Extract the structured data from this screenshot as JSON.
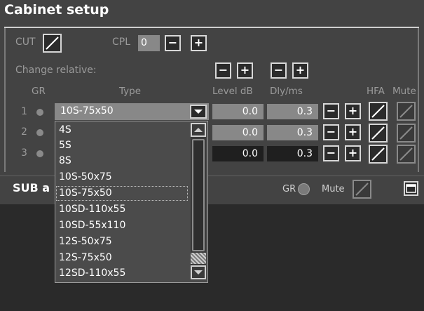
{
  "window_title": "Cabinet setup",
  "top_controls": {
    "cut_label": "CUT",
    "cpl_label": "CPL",
    "cpl_value": "0",
    "minus": "−",
    "plus": "+"
  },
  "change_relative_label": "Change relative:",
  "headers": {
    "gr": "GR",
    "type": "Type",
    "level": "Level dB",
    "dly": "Dly/ms",
    "hfa": "HFA",
    "mute": "Mute"
  },
  "rows": [
    {
      "gr": "1",
      "type": "10S-75x50",
      "level": "0.0",
      "dly": "0.3"
    },
    {
      "gr": "2",
      "level": "0.0",
      "dly": "0.3"
    },
    {
      "gr": "3",
      "level": "0.0",
      "dly": "0.3"
    }
  ],
  "dropdown_options": [
    "4S",
    "5S",
    "8S",
    "10S-50x75",
    "10S-75x50",
    "10SD-110x55",
    "10SD-55x110",
    "12S-50x75",
    "12S-75x50",
    "12SD-110x55"
  ],
  "dropdown_selected": "10S-75x50",
  "sub_section": {
    "title": "SUB a",
    "gr_label": "GR",
    "mute_label": "Mute"
  },
  "colors": {
    "panel_bg": "#434343",
    "field_gray": "#888888",
    "field_dark": "#1f1f1f",
    "border_light": "#d8d8d8",
    "text_dim": "#9a9a9a"
  },
  "icons": [
    "slash-toggle-icon",
    "minus-icon",
    "plus-icon",
    "dropdown-arrow-icon",
    "scroll-up-icon",
    "scroll-down-icon",
    "window-restore-icon",
    "status-dot-icon"
  ]
}
